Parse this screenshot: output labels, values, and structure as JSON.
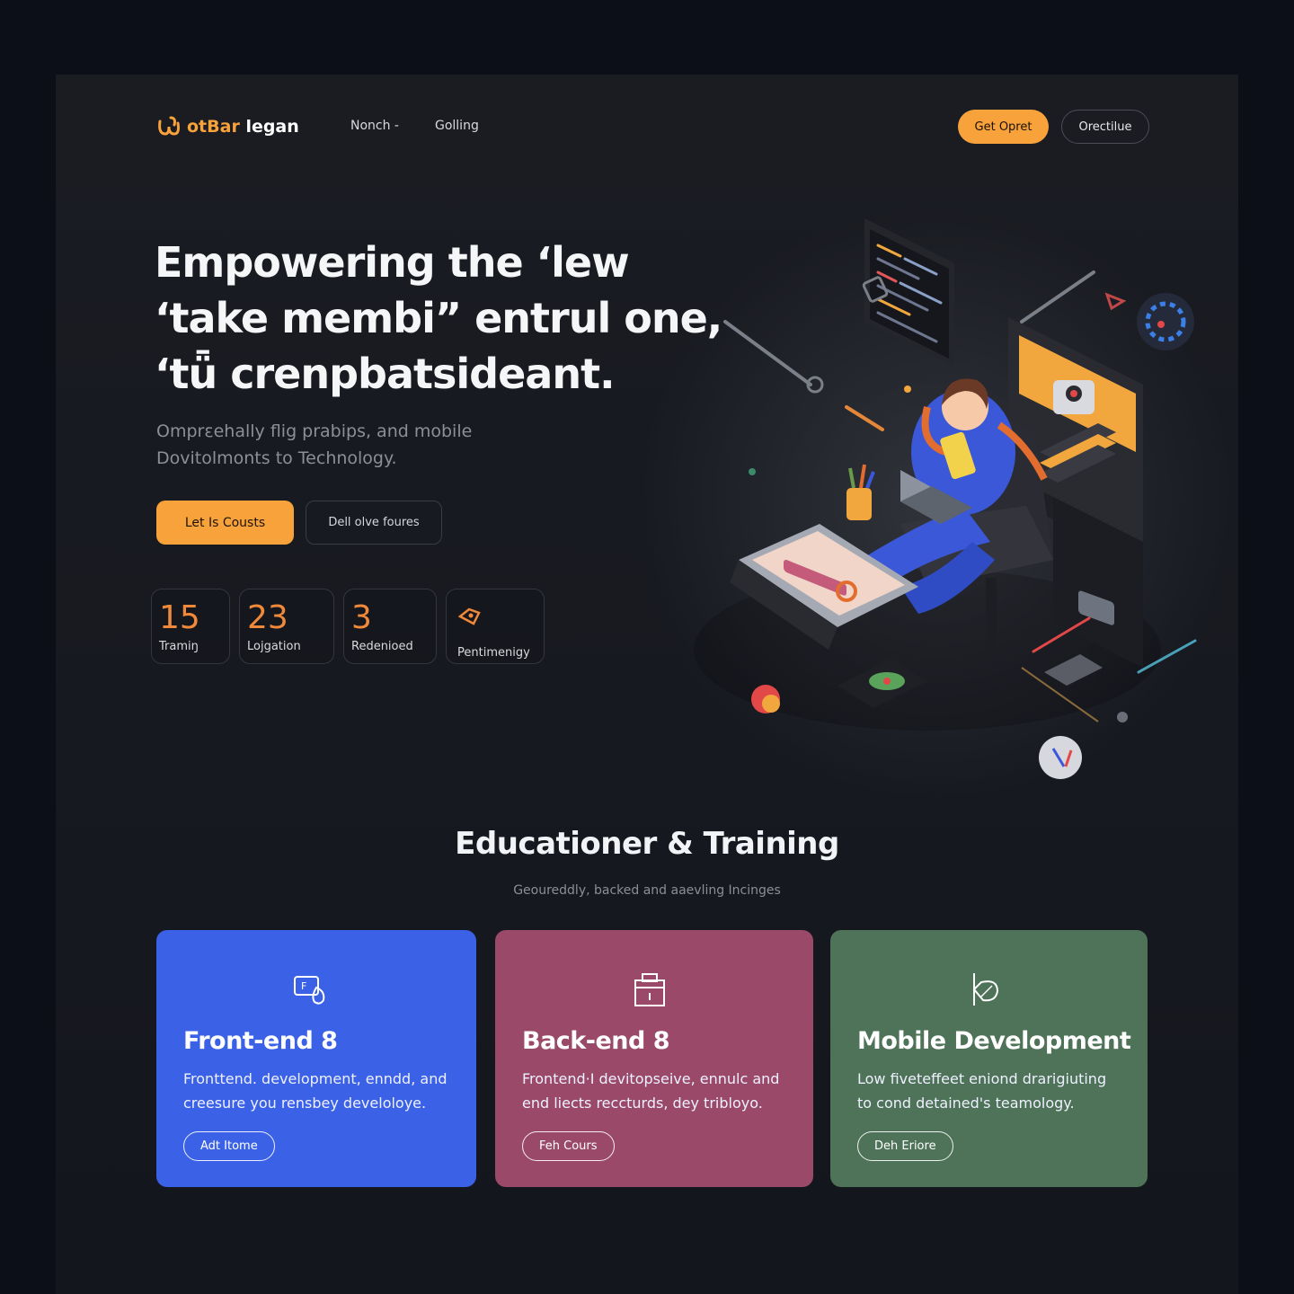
{
  "brand": {
    "name_a": "otBar",
    "name_b": "legan",
    "accent": "#f7a23b"
  },
  "nav": {
    "items": [
      "Nonch -",
      "Golling"
    ],
    "primary_label": "Get Opret",
    "outline_label": "Orectilue"
  },
  "hero": {
    "title_lines": [
      "Empowering the ‘lew",
      "‘take membi” entrul one,",
      "‘tǖ crenpbatsideant."
    ],
    "subtitle_lines": [
      "Omprεehally flig prabips, and mobile",
      "Dovitolmonts to Technology."
    ],
    "primary_cta": "Let Is Cousts",
    "secondary_cta": "Dell olve foures"
  },
  "stats": [
    {
      "value": "15",
      "label": "Tramiŋ"
    },
    {
      "value": "23",
      "label": "Lojgation"
    },
    {
      "value": "3",
      "label": "Redenioed"
    },
    {
      "value": "",
      "label": "Pentimenigy",
      "icon": "tag-icon"
    }
  ],
  "section": {
    "title": "Educationer & Training",
    "subtitle": "Geoureddly, backed and aaevling Incinges"
  },
  "cards": [
    {
      "title": "Front-end 8",
      "desc_lines": [
        "Fronttend. development, enndd, and",
        "creesure you rensbey develoloye."
      ],
      "cta": "Adt Itome",
      "color": "#3b62e6",
      "icon": "code-file-icon"
    },
    {
      "title": "Back-end 8",
      "desc_lines": [
        "Frontend·I devitopseive, ennulc and",
        "end liects reccturds, dey tribloyo."
      ],
      "cta": "Feh Cours",
      "color": "#9a4a68",
      "icon": "clipboard-icon"
    },
    {
      "title": "Mobile Development",
      "desc_lines": [
        "Low fiveteffeet eniond drarigiuting",
        "to cond detained's teamology."
      ],
      "cta": "Deh Eriore",
      "color": "#4e7358",
      "icon": "leaf-icon"
    }
  ]
}
